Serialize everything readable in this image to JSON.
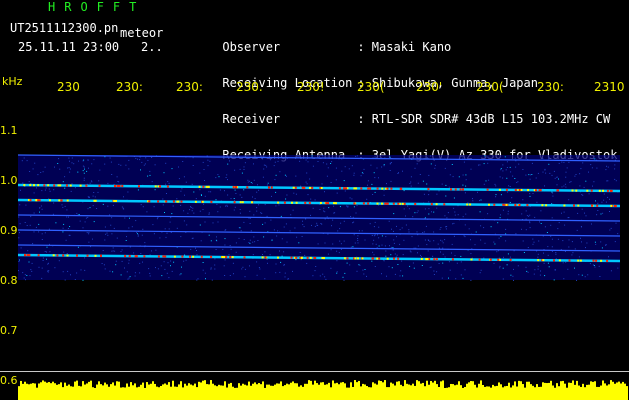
{
  "header": {
    "brand": "HROFFT",
    "file_name": "UT2511112300.pn",
    "file_tag": "meteor",
    "date_time": "25.11.11 23:00",
    "counter": "2.."
  },
  "station": [
    {
      "key": "Observer",
      "value": ": Masaki Kano"
    },
    {
      "key": "Receiving Location",
      "value": ": Shibukawa, Gunma, Japan"
    },
    {
      "key": "Receiver",
      "value": ": RTL-SDR SDR# 43dB L15 103.2MHz CW"
    },
    {
      "key": "Receiving Antenna",
      "value": ": 3el Yagi(V) Az 330 for Vladivostok"
    }
  ],
  "axis": {
    "y_unit": "kHz",
    "x_ticks": [
      "230",
      "230:",
      "230:",
      "230.",
      "230!",
      "230(",
      "230'",
      "230(",
      "230:",
      "2310"
    ],
    "y_ticks": [
      "1.1",
      "1.0",
      "0.9",
      "0.8",
      "0.7",
      "0.6"
    ]
  },
  "colors": {
    "text_green": "#22ee22",
    "text_yellow": "#f0f000",
    "text_white": "#ffffff",
    "background": "#000000",
    "spectrogram_low": "#000070",
    "spectrogram_mid": "#00c8ff",
    "spectrogram_high": "#ffff00",
    "spectrogram_peak": "#ff2000"
  },
  "chart_data": {
    "type": "heatmap",
    "x_ticks": [
      "230",
      "230:",
      "230:",
      "230.",
      "230!",
      "230(",
      "230'",
      "230(",
      "230:",
      "2310"
    ],
    "y_ticks": [
      1.1,
      1.0,
      0.9,
      0.8,
      0.7,
      0.6
    ],
    "ylabel": "kHz",
    "ylim": [
      0.6,
      1.1
    ],
    "noise_band_khz": [
      0.8,
      1.05
    ],
    "carrier_lines_khz": [
      1.05,
      0.99,
      0.96,
      0.93,
      0.9,
      0.87,
      0.85
    ],
    "bright_lines_khz": [
      0.99,
      0.96,
      0.92,
      0.85
    ]
  }
}
